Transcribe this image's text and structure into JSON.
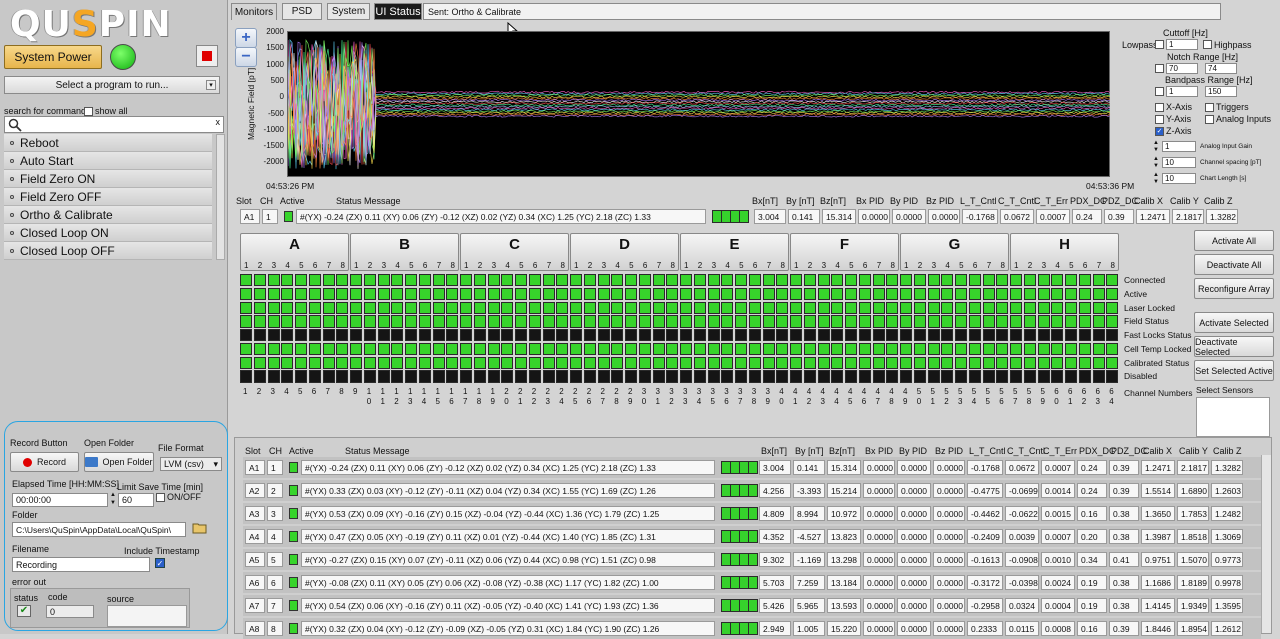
{
  "logo": {
    "pre": "QU",
    "accent": "S",
    "post": "PIN"
  },
  "left": {
    "system_power": "System Power",
    "program_select": "Select a program to run...",
    "search_label": "search for command",
    "show_all": "show all",
    "search_clear": "x",
    "commands": [
      "Reboot",
      "Auto Start",
      "Field Zero ON",
      "Field Zero OFF",
      "Ortho & Calibrate",
      "Closed Loop ON",
      "Closed Loop OFF"
    ]
  },
  "record": {
    "record_button_label": "Record Button",
    "record": "Record",
    "open_folder_label": "Open Folder",
    "open_folder": "Open Folder",
    "file_format_label": "File Format",
    "file_format": "LVM (csv)",
    "elapsed_label": "Elapsed Time [HH:MM:SS]",
    "elapsed": "00:00:00",
    "limit_label": "Limit Save Time [min]",
    "limit": "60",
    "onoff": "ON/OFF",
    "folder_label": "Folder",
    "folder": "C:\\Users\\QuSpin\\AppData\\Local\\QuSpin\\",
    "filename_label": "Filename",
    "filename": "Recording",
    "include_ts": "Include Timestamp",
    "error_out": "error out",
    "status": "status",
    "code": "code",
    "code_val": "0",
    "source": "source"
  },
  "tabs": [
    "Monitors",
    "PSD",
    "System",
    "UI Status"
  ],
  "sent": "Sent: Ortho & Calibrate",
  "graph": {
    "ylabel": "Magnetic Field [pT]",
    "yticks": [
      "2000",
      "1500",
      "1000",
      "500",
      "0",
      "-500",
      "-1000",
      "-1500",
      "-2000"
    ],
    "x_start": "04:53:26 PM",
    "x_end": "04:53:36 PM"
  },
  "controls": {
    "cutoff": "Cuttoff [Hz]",
    "lowpass": "Lowpass",
    "lowpass_val": "1",
    "highpass": "Highpass",
    "notch": "Notch Range [Hz]",
    "notch_lo": "70",
    "notch_hi": "74",
    "bandpass": "Bandpass Range [Hz]",
    "band_lo": "1",
    "band_hi": "150",
    "xaxis": "X-Axis",
    "yaxis": "Y-Axis",
    "zaxis": "Z-Axis",
    "triggers": "Triggers",
    "analog": "Analog Inputs",
    "gain_val": "1",
    "gain": "Analog Input Gain",
    "spacing_val": "10",
    "spacing": "Channel spacing [pT]",
    "length_val": "10",
    "length": "Chart Length [s]"
  },
  "table_headers": [
    "Slot",
    "CH",
    "Active",
    "Status Message",
    "Bx[nT]",
    "By [nT]",
    "Bz[nT]",
    "Bx PID",
    "By PID",
    "Bz PID",
    "L_T_Cntl",
    "C_T_Cntl",
    "C_T_Err",
    "PDX_DC",
    "PDZ_DC",
    "Calib X",
    "Calib Y",
    "Calib Z"
  ],
  "top_row": {
    "slot": "A1",
    "ch": "1",
    "msg": "#(YX) -0.24 (ZX) 0.11 (XY) 0.06 (ZY) -0.12 (XZ) 0.02 (YZ) 0.34 (XC) 1.25 (YC) 2.18 (ZC) 1.33",
    "vals": [
      "3.004",
      "0.141",
      "15.314",
      "0.0000",
      "0.0000",
      "0.0000",
      "-0.1768",
      "0.0672",
      "0.0007",
      "0.24",
      "0.39",
      "1.2471",
      "2.1817",
      "1.3282"
    ]
  },
  "groups": [
    "A",
    "B",
    "C",
    "D",
    "E",
    "F",
    "G",
    "H"
  ],
  "group_nums": [
    "1",
    "2",
    "3",
    "4",
    "5",
    "6",
    "7",
    "8"
  ],
  "grid_rows": [
    {
      "label": "Connected",
      "color": "green"
    },
    {
      "label": "Active",
      "color": "green"
    },
    {
      "label": "Laser Locked",
      "color": "green"
    },
    {
      "label": "Field Status",
      "color": "green"
    },
    {
      "label": "Fast Locks Status",
      "color": "black"
    },
    {
      "label": "Cell Temp Locked",
      "color": "green"
    },
    {
      "label": "Calibrated Status",
      "color": "green"
    },
    {
      "label": "Disabled",
      "color": "black"
    }
  ],
  "channel_numbers_label": "Channel Numbers",
  "right_buttons": [
    "Activate All",
    "Deactivate All",
    "Reconfigure Array",
    "Activate Selected",
    "Deactivate Selected",
    "Set Selected Active"
  ],
  "select_sensors": "Select Sensors",
  "rows": [
    {
      "slot": "A1",
      "ch": "1",
      "msg": "#(YX) -0.24 (ZX) 0.11 (XY) 0.06 (ZY) -0.12 (XZ) 0.02 (YZ) 0.34 (XC) 1.25 (YC) 2.18 (ZC) 1.33",
      "vals": [
        "3.004",
        "0.141",
        "15.314",
        "0.0000",
        "0.0000",
        "0.0000",
        "-0.1768",
        "0.0672",
        "0.0007",
        "0.24",
        "0.39",
        "1.2471",
        "2.1817",
        "1.3282"
      ]
    },
    {
      "slot": "A2",
      "ch": "2",
      "msg": "#(YX) 0.33 (ZX) 0.03 (XY) -0.12 (ZY) -0.11 (XZ) 0.04 (YZ) 0.34 (XC) 1.55 (YC) 1.69 (ZC) 1.26",
      "vals": [
        "4.256",
        "-3.393",
        "15.214",
        "0.0000",
        "0.0000",
        "0.0000",
        "-0.4775",
        "-0.0699",
        "0.0014",
        "0.24",
        "0.39",
        "1.5514",
        "1.6890",
        "1.2603"
      ]
    },
    {
      "slot": "A3",
      "ch": "3",
      "msg": "#(YX) 0.53 (ZX) 0.09 (XY) -0.16 (ZY) 0.15 (XZ) -0.04 (YZ) -0.44 (XC) 1.36 (YC) 1.79 (ZC) 1.25",
      "vals": [
        "4.809",
        "8.994",
        "10.972",
        "0.0000",
        "0.0000",
        "0.0000",
        "-0.4462",
        "-0.0622",
        "0.0015",
        "0.16",
        "0.38",
        "1.3650",
        "1.7853",
        "1.2482"
      ]
    },
    {
      "slot": "A4",
      "ch": "4",
      "msg": "#(YX) 0.47 (ZX) 0.05 (XY) -0.19 (ZY) 0.11 (XZ) 0.01 (YZ) -0.44 (XC) 1.40 (YC) 1.85 (ZC) 1.31",
      "vals": [
        "4.352",
        "-4.527",
        "13.823",
        "0.0000",
        "0.0000",
        "0.0000",
        "-0.2409",
        "0.0039",
        "0.0007",
        "0.20",
        "0.38",
        "1.3987",
        "1.8518",
        "1.3069"
      ]
    },
    {
      "slot": "A5",
      "ch": "5",
      "msg": "#(YX) -0.27 (ZX) 0.15 (XY) 0.07 (ZY) -0.11 (XZ) 0.06 (YZ) 0.44 (XC) 0.98 (YC) 1.51 (ZC) 0.98",
      "vals": [
        "9.302",
        "-1.169",
        "13.298",
        "0.0000",
        "0.0000",
        "0.0000",
        "-0.1613",
        "-0.0908",
        "0.0010",
        "0.34",
        "0.41",
        "0.9751",
        "1.5070",
        "0.9773"
      ]
    },
    {
      "slot": "A6",
      "ch": "6",
      "msg": "#(YX) -0.08 (ZX) 0.11 (XY) 0.05 (ZY) 0.06 (XZ) -0.08 (YZ) -0.38 (XC) 1.17 (YC) 1.82 (ZC) 1.00",
      "vals": [
        "5.703",
        "7.259",
        "13.184",
        "0.0000",
        "0.0000",
        "0.0000",
        "-0.3172",
        "-0.0398",
        "0.0024",
        "0.19",
        "0.38",
        "1.1686",
        "1.8189",
        "0.9978"
      ]
    },
    {
      "slot": "A7",
      "ch": "7",
      "msg": "#(YX) 0.54 (ZX) 0.06 (XY) -0.16 (ZY) 0.11 (XZ) -0.05 (YZ) -0.40 (XC) 1.41 (YC) 1.93 (ZC) 1.36",
      "vals": [
        "5.426",
        "5.965",
        "13.593",
        "0.0000",
        "0.0000",
        "0.0000",
        "-0.2958",
        "0.0324",
        "0.0004",
        "0.19",
        "0.38",
        "1.4145",
        "1.9349",
        "1.3595"
      ]
    },
    {
      "slot": "A8",
      "ch": "8",
      "msg": "#(YX) 0.32 (ZX) 0.04 (XY) -0.12 (ZY) -0.09 (XZ) -0.05 (YZ) 0.31 (XC) 1.84 (YC) 1.90 (ZC) 1.26",
      "vals": [
        "2.949",
        "1.005",
        "15.220",
        "0.0000",
        "0.0000",
        "0.0000",
        "0.2333",
        "0.0115",
        "0.0008",
        "0.16",
        "0.39",
        "1.8446",
        "1.8954",
        "1.2612"
      ]
    }
  ],
  "colors": {
    "accent": "#f5a623",
    "led_green": "#37d42b",
    "panel_border": "#2aa5e2",
    "plot_bg": "#000000"
  }
}
